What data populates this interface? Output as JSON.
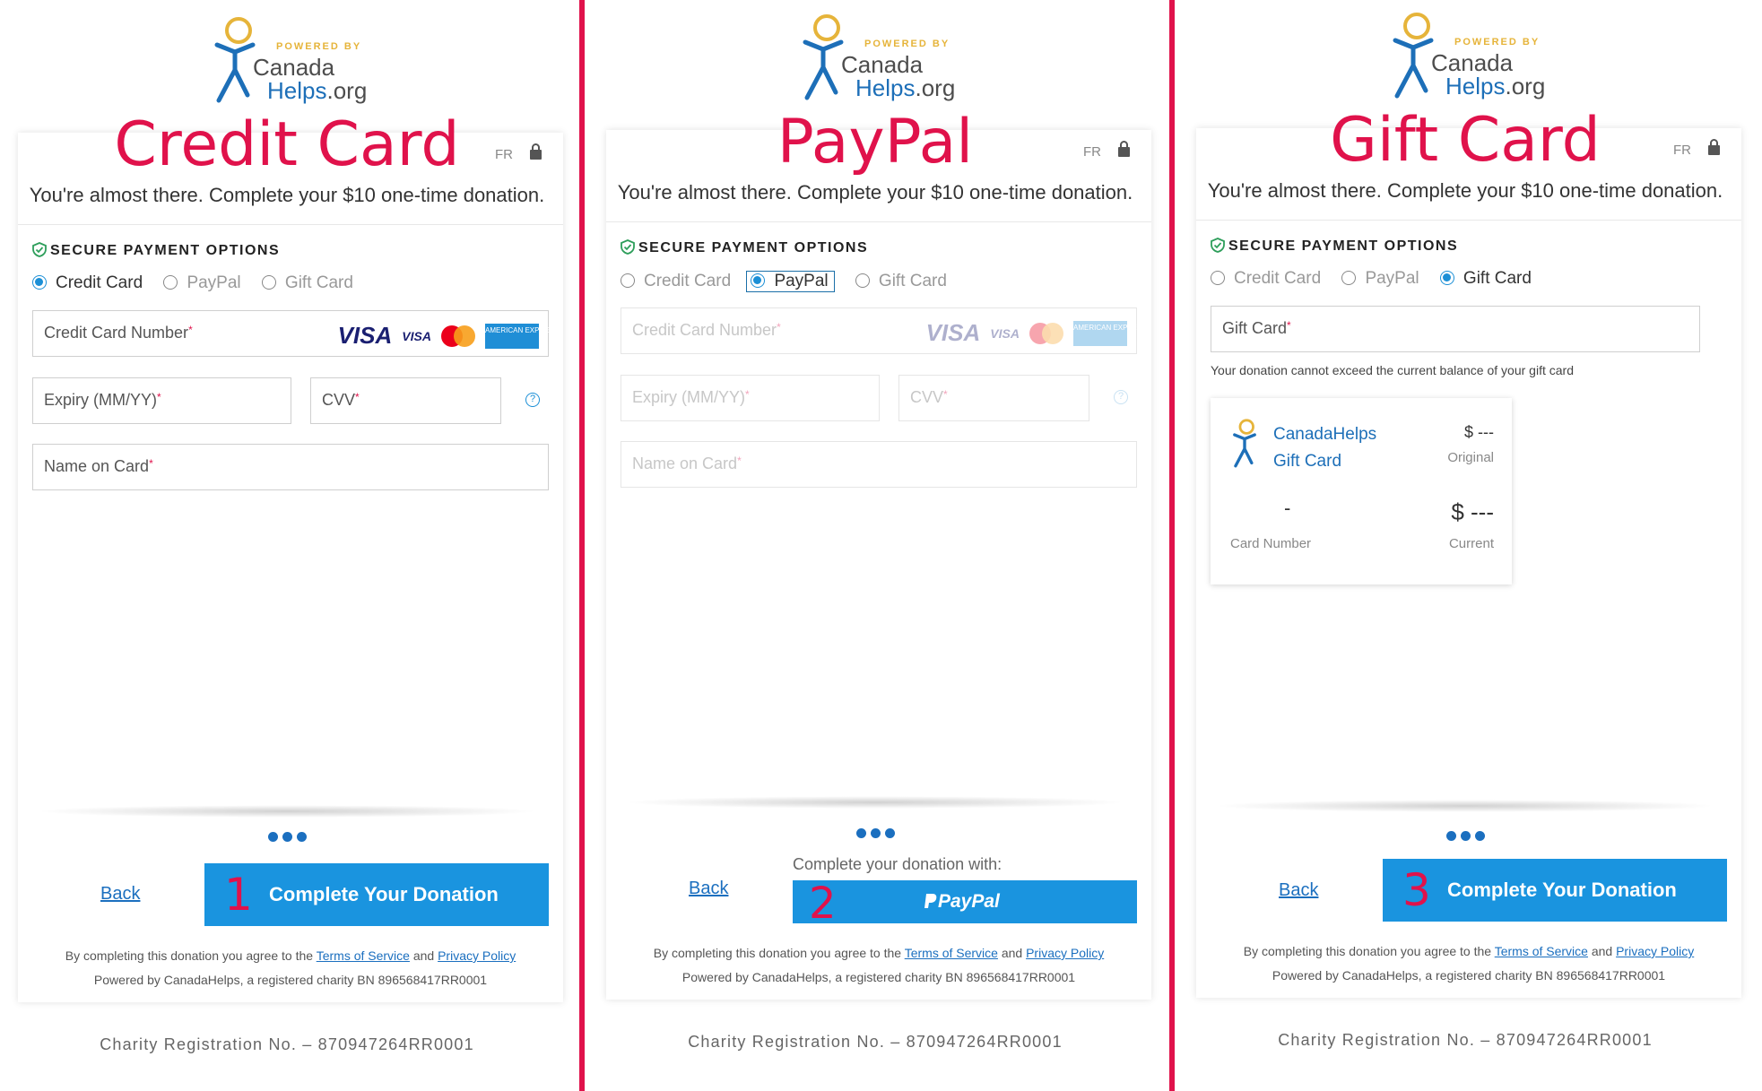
{
  "colors": {
    "accent": "#e0124b",
    "button": "#1a94df",
    "link": "#1b6fbf"
  },
  "logo": {
    "powered": "POWERED BY",
    "canada": "Canada",
    "helps": "Helps",
    "org": ".org"
  },
  "common": {
    "lang": "FR",
    "subtitle": "You're almost there. Complete your $10 one-time donation.",
    "secure": "SECURE PAYMENT OPTIONS",
    "options": [
      "Credit Card",
      "PayPal",
      "Gift Card"
    ],
    "back": "Back",
    "complete": "Complete Your Donation",
    "terms_pre": "By completing this donation you agree to the",
    "terms_link": "Terms of Service",
    "terms_and": "and",
    "privacy_link": "Privacy Policy",
    "powered_line": "Powered by CanadaHelps, a registered charity BN 896568417RR0001",
    "charity": "Charity Registration No.  –  870947264RR0001",
    "cc_number": "Credit Card Number",
    "expiry": "Expiry (MM/YY)",
    "cvv": "CVV",
    "name_on_card": "Name on Card",
    "req": "*",
    "visa": "VISA",
    "visa_small": "VISA",
    "amex": "AMERICAN EXPRESS",
    "help": "?"
  },
  "panels": {
    "credit": {
      "title": "Credit Card",
      "step": "1"
    },
    "paypal": {
      "title": "PayPal",
      "step": "2",
      "note": "Complete your donation with:",
      "paypal_label": "PayPal"
    },
    "gift": {
      "title": "Gift Card",
      "step": "3",
      "field": "Gift Card",
      "note": "Your donation cannot exceed the current balance of your gift card",
      "card_name_1": "CanadaHelps",
      "card_name_2": "Gift Card",
      "original_amount": "$ ---",
      "original_label": "Original",
      "card_number_value": "-",
      "card_number_label": "Card Number",
      "current_amount": "$ ---",
      "current_label": "Current"
    }
  }
}
